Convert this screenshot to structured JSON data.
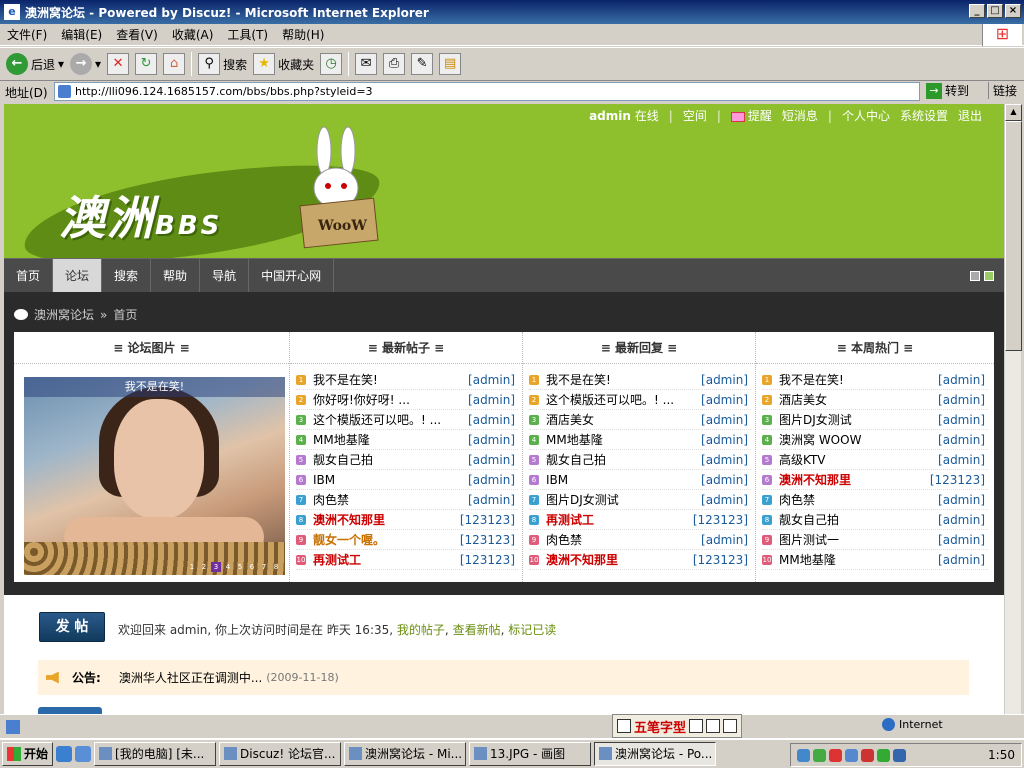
{
  "window": {
    "title": "澳洲窝论坛 - Powered by Discuz! - Microsoft Internet Explorer"
  },
  "menu": [
    "文件(F)",
    "编辑(E)",
    "查看(V)",
    "收藏(A)",
    "工具(T)",
    "帮助(H)"
  ],
  "toolbar": {
    "back": "后退",
    "search": "搜索",
    "favorites": "收藏夹"
  },
  "address": {
    "label": "地址(D)",
    "url": "http://lli096.124.1685157.com/bbs/bbs.php?styleid=3",
    "go": "转到",
    "links": "链接"
  },
  "userbar": {
    "user": "admin",
    "status": "在线",
    "space": "空间",
    "remind": "提醒",
    "pm": "短消息",
    "center": "个人中心",
    "settings": "系统设置",
    "logout": "退出"
  },
  "logo": {
    "main": "澳洲",
    "bbs": "BBS",
    "sign": "WooW"
  },
  "nav": [
    "首页",
    "论坛",
    "搜索",
    "帮助",
    "导航",
    "中国开心网"
  ],
  "breadcrumb": {
    "forum": "澳洲窝论坛",
    "sep": "»",
    "page": "首页"
  },
  "columns": {
    "images": {
      "title": "≡ 论坛图片 ≡",
      "caption": "我不是在笑!",
      "pages": [
        "1",
        "2",
        "3",
        "4",
        "5",
        "6",
        "7",
        "8"
      ],
      "active_page": 3
    },
    "posts": {
      "title": "≡ 最新帖子 ≡",
      "items": [
        {
          "n": "1",
          "t": "我不是在笑!",
          "a": "[admin]",
          "s": ""
        },
        {
          "n": "2",
          "t": "你好呀!你好呀! ...",
          "a": "[admin]",
          "s": ""
        },
        {
          "n": "3",
          "t": "这个模版还可以吧。! ...",
          "a": "[admin]",
          "s": ""
        },
        {
          "n": "4",
          "t": "MM地基隆",
          "a": "[admin]",
          "s": ""
        },
        {
          "n": "5",
          "t": "靓女自己拍",
          "a": "[admin]",
          "s": ""
        },
        {
          "n": "6",
          "t": "IBM",
          "a": "[admin]",
          "s": ""
        },
        {
          "n": "7",
          "t": "肉色禁",
          "a": "[admin]",
          "s": ""
        },
        {
          "n": "8",
          "t": "澳洲不知那里",
          "a": "[123123]",
          "s": "red"
        },
        {
          "n": "9",
          "t": "靓女一个喔。",
          "a": "[123123]",
          "s": "orange"
        },
        {
          "n": "10",
          "t": "再测试工",
          "a": "[123123]",
          "s": "red"
        }
      ]
    },
    "replies": {
      "title": "≡ 最新回复 ≡",
      "items": [
        {
          "n": "1",
          "t": "我不是在笑!",
          "a": "[admin]",
          "s": ""
        },
        {
          "n": "2",
          "t": "这个模版还可以吧。! ...",
          "a": "[admin]",
          "s": ""
        },
        {
          "n": "3",
          "t": "酒店美女",
          "a": "[admin]",
          "s": ""
        },
        {
          "n": "4",
          "t": "MM地基隆",
          "a": "[admin]",
          "s": ""
        },
        {
          "n": "5",
          "t": "靓女自己拍",
          "a": "[admin]",
          "s": ""
        },
        {
          "n": "6",
          "t": "IBM",
          "a": "[admin]",
          "s": ""
        },
        {
          "n": "7",
          "t": "图片DJ女测试",
          "a": "[admin]",
          "s": ""
        },
        {
          "n": "8",
          "t": "再测试工",
          "a": "[123123]",
          "s": "red"
        },
        {
          "n": "9",
          "t": "肉色禁",
          "a": "[admin]",
          "s": ""
        },
        {
          "n": "10",
          "t": "澳洲不知那里",
          "a": "[123123]",
          "s": "red"
        }
      ]
    },
    "hot": {
      "title": "≡ 本周热门 ≡",
      "items": [
        {
          "n": "1",
          "t": "我不是在笑!",
          "a": "[admin]",
          "s": ""
        },
        {
          "n": "2",
          "t": "酒店美女",
          "a": "[admin]",
          "s": ""
        },
        {
          "n": "3",
          "t": "图片DJ女测试",
          "a": "[admin]",
          "s": ""
        },
        {
          "n": "4",
          "t": "澳洲窝 WOOW",
          "a": "[admin]",
          "s": ""
        },
        {
          "n": "5",
          "t": "高级KTV",
          "a": "[admin]",
          "s": ""
        },
        {
          "n": "6",
          "t": "澳洲不知那里",
          "a": "[123123]",
          "s": "red"
        },
        {
          "n": "7",
          "t": "肉色禁",
          "a": "[admin]",
          "s": ""
        },
        {
          "n": "8",
          "t": "靓女自己拍",
          "a": "[admin]",
          "s": ""
        },
        {
          "n": "9",
          "t": "图片测试一",
          "a": "[admin]",
          "s": ""
        },
        {
          "n": "10",
          "t": "MM地基隆",
          "a": "[admin]",
          "s": ""
        }
      ]
    }
  },
  "post_button": "发 帖",
  "welcome": {
    "text": "欢迎回来 admin, 你上次访问时间是在 昨天 16:35,",
    "my_posts": "我的帖子",
    "new_posts": "查看新帖",
    "mark_read": "标记已读"
  },
  "notice": {
    "label": "公告:",
    "text": "澳洲华人社区正在调测中...",
    "date": "(2009-11-18)"
  },
  "status": {
    "ime": "五笔字型",
    "zone": "Internet"
  },
  "taskbar": {
    "start": "开始",
    "tasks": [
      "[我的电脑] [未...",
      "Discuz! 论坛官...",
      "澳洲窝论坛 - Mi...",
      "13.JPG - 画图",
      "澳洲窝论坛 - Po..."
    ],
    "active_task": 4,
    "clock": "1:50"
  },
  "colors": {
    "banner": "#8dc02c",
    "nav": "#4a4a4a",
    "dark": "#2b2b2b",
    "num": [
      "#e9a52a",
      "#e9a52a",
      "#5ab04a",
      "#5ab04a",
      "#b57ad0",
      "#b57ad0",
      "#3aa0d0",
      "#3aa0d0",
      "#e05a7a",
      "#e05a7a"
    ]
  }
}
